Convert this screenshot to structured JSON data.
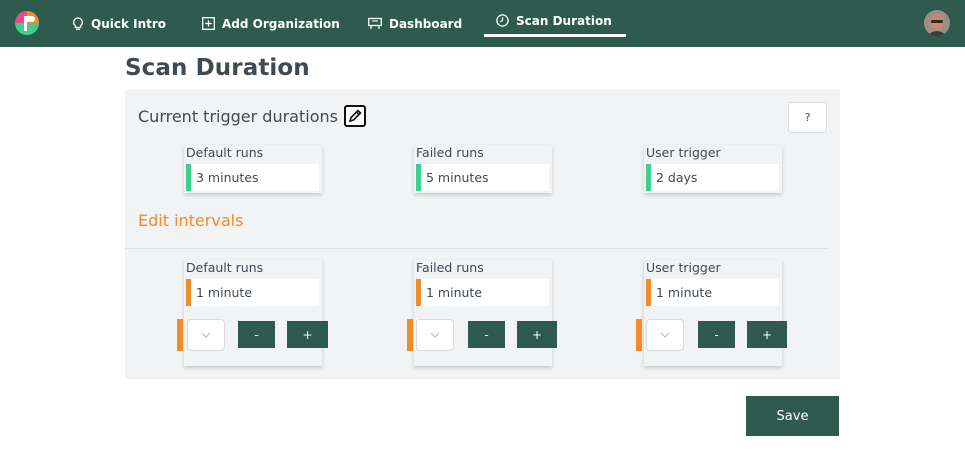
{
  "nav": {
    "items": [
      {
        "label": "Quick Intro",
        "icon": "lightbulb-icon"
      },
      {
        "label": "Add Organization",
        "icon": "plus-square-icon"
      },
      {
        "label": "Dashboard",
        "icon": "dashboard-icon"
      },
      {
        "label": "Scan Duration",
        "icon": "clock-icon",
        "active": true
      }
    ]
  },
  "page": {
    "title": "Scan Duration"
  },
  "current": {
    "title": "Current trigger durations",
    "help_label": "?",
    "cards": [
      {
        "label": "Default runs",
        "value": "3 minutes"
      },
      {
        "label": "Failed runs",
        "value": "5 minutes"
      },
      {
        "label": "User trigger",
        "value": "2 days"
      }
    ]
  },
  "edit": {
    "title": "Edit intervals",
    "cards": [
      {
        "label": "Default runs",
        "value": "1 minute"
      },
      {
        "label": "Failed runs",
        "value": "1 minute"
      },
      {
        "label": "User trigger",
        "value": "1 minute"
      }
    ],
    "minus_label": "-",
    "plus_label": "+"
  },
  "save_label": "Save",
  "colors": {
    "primary": "#2e5b4d",
    "accent_orange": "#f08c2a",
    "accent_green": "#3ecf8e",
    "panel_bg": "#f2f3f4"
  }
}
